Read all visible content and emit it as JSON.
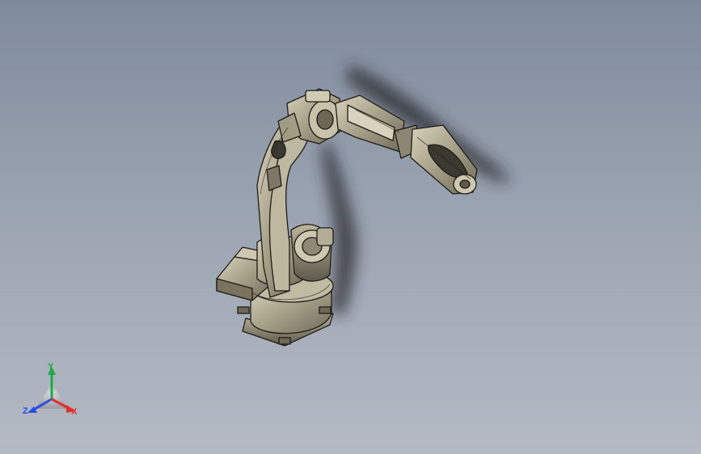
{
  "viewport": {
    "background_top": "#7f8a9b",
    "background_bottom": "#b5bac4"
  },
  "model": {
    "subject": "six-axis-industrial-robot-arm",
    "render_style": "shaded-with-edges",
    "body_color": "#a8a089",
    "edge_color": "#1c1c18",
    "shadow_color": "#25272c"
  },
  "triad": {
    "y_label": "Y",
    "z_label": "Z",
    "x_label": "X",
    "y_color": "#1fa84a",
    "z_color": "#2b4ce0",
    "x_color": "#e0302b"
  }
}
